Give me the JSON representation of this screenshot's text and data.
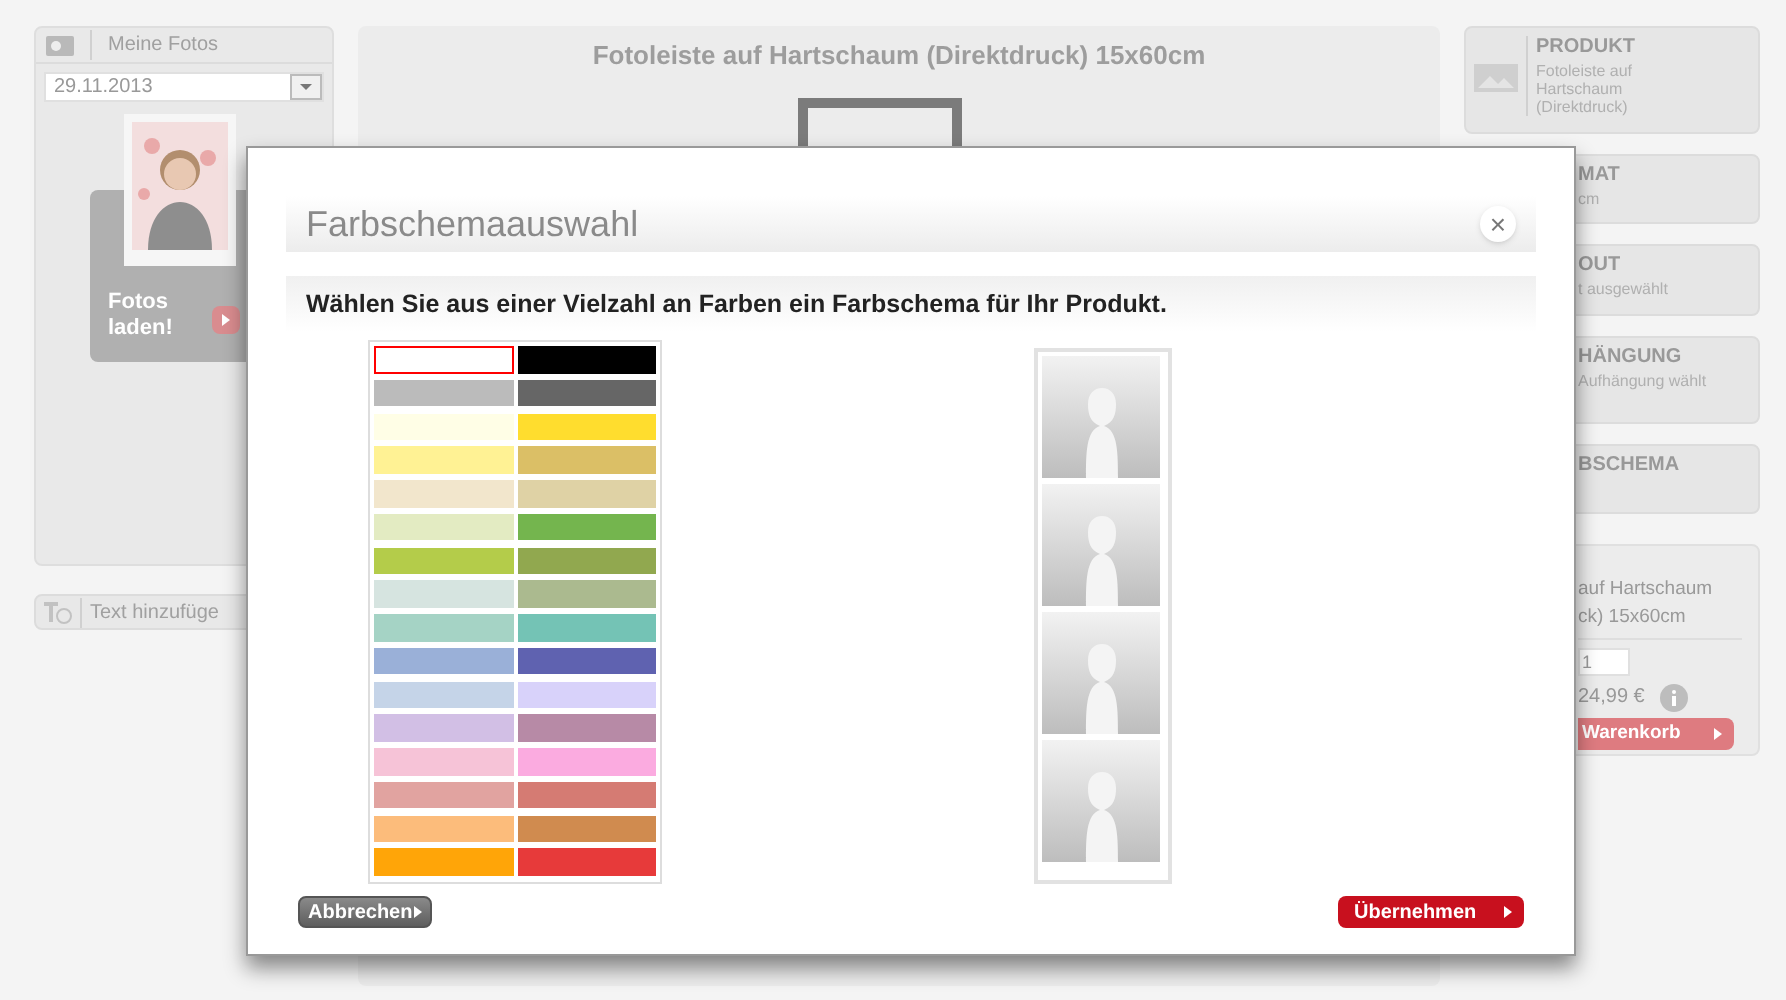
{
  "sidebar": {
    "header": "Meine Fotos",
    "date": "29.11.2013",
    "upload_button": "Fotos laden!",
    "text_button": "Text hinzufüge"
  },
  "product_title": "Fotoleiste auf Hartschaum (Direktdruck) 15x60cm",
  "steps": [
    {
      "kind": "full",
      "title": "PRODUKT",
      "detail": "Fotoleiste auf Hartschaum (Direktdruck)"
    },
    {
      "kind": "cut",
      "title": "MAT",
      "detail": "cm"
    },
    {
      "kind": "cut",
      "title": "OUT",
      "detail": "t ausgewählt"
    },
    {
      "kind": "cut",
      "title": "HÄNGUNG",
      "detail": "Aufhängung wählt"
    },
    {
      "kind": "cut",
      "title": "BSCHEMA"
    }
  ],
  "cart": {
    "product_lines": [
      "auf Hartschaum",
      "ck) 15x60cm"
    ],
    "quantity": "1",
    "price": "24,99 €",
    "button": "Warenkorb"
  },
  "dialog": {
    "title": "Farbschemaauswahl",
    "close": "×",
    "instruction": "Wählen Sie aus einer Vielzahl an Farben ein Farbschema für Ihr Produkt.",
    "swatches": [
      {
        "color": "#ffffff",
        "selected": true
      },
      {
        "color": "#000000",
        "selected": false
      },
      {
        "color": "#bbbbbb",
        "selected": false
      },
      {
        "color": "#666666",
        "selected": false
      },
      {
        "color": "#fffee6",
        "selected": false
      },
      {
        "color": "#ffdd2e",
        "selected": false
      },
      {
        "color": "#fff294",
        "selected": false
      },
      {
        "color": "#dbbf66",
        "selected": false
      },
      {
        "color": "#f2e6cc",
        "selected": false
      },
      {
        "color": "#dfd2a5",
        "selected": false
      },
      {
        "color": "#e3ebc2",
        "selected": false
      },
      {
        "color": "#74b54e",
        "selected": false
      },
      {
        "color": "#b4cc4a",
        "selected": false
      },
      {
        "color": "#91a84f",
        "selected": false
      },
      {
        "color": "#d6e4e0",
        "selected": false
      },
      {
        "color": "#abba8f",
        "selected": false
      },
      {
        "color": "#a5d3c5",
        "selected": false
      },
      {
        "color": "#74c3b5",
        "selected": false
      },
      {
        "color": "#9ab0d8",
        "selected": false
      },
      {
        "color": "#5f62b0",
        "selected": false
      },
      {
        "color": "#c5d4e8",
        "selected": false
      },
      {
        "color": "#d8d2fa",
        "selected": false
      },
      {
        "color": "#d2bfe5",
        "selected": false
      },
      {
        "color": "#b78aa6",
        "selected": false
      },
      {
        "color": "#f6c3d7",
        "selected": false
      },
      {
        "color": "#fbabe0",
        "selected": false
      },
      {
        "color": "#e1a3a0",
        "selected": false
      },
      {
        "color": "#d57b73",
        "selected": false
      },
      {
        "color": "#fcbc7b",
        "selected": false
      },
      {
        "color": "#d08b4f",
        "selected": false
      },
      {
        "color": "#ffa508",
        "selected": false
      },
      {
        "color": "#e73a3a",
        "selected": false
      }
    ],
    "buttons": [
      {
        "kind": "cancel",
        "label": "Abbrechen"
      },
      {
        "kind": "confirm",
        "label": "Übernehmen"
      }
    ]
  }
}
